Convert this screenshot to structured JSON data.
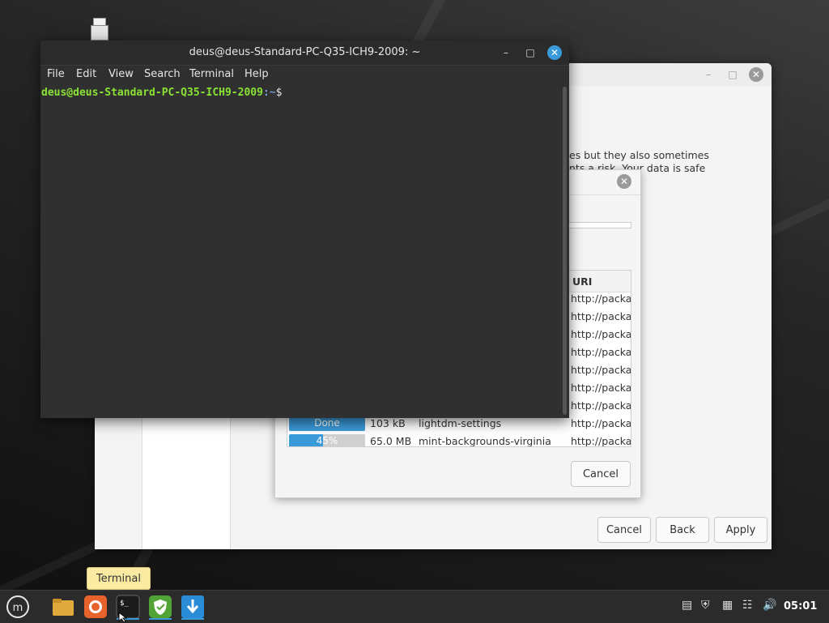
{
  "terminal": {
    "title": "deus@deus-Standard-PC-Q35-ICH9-2009: ~",
    "menu": [
      "File",
      "Edit",
      "View",
      "Search",
      "Terminal",
      "Help"
    ],
    "prompt_user": "deus@deus-Standard-PC-Q35-ICH9-2009",
    "prompt_path": ":~",
    "prompt_symbol": "$"
  },
  "back_window": {
    "text_line1": "es but they also sometimes",
    "text_line2": "nts a risk. Your data is safe",
    "buttons": {
      "cancel": "Cancel",
      "back": "Back",
      "apply": "Apply"
    }
  },
  "download_dialog": {
    "column_uri": "URI",
    "rows": [
      {
        "status": "",
        "size": "",
        "name": "",
        "uri": "http://packa"
      },
      {
        "status": "",
        "size": "",
        "name": "",
        "uri": "http://packa"
      },
      {
        "status": "",
        "size": "",
        "name": "",
        "uri": "http://packa"
      },
      {
        "status": "",
        "size": "",
        "name": "",
        "uri": "http://packa"
      },
      {
        "status": "",
        "size": "",
        "name": "",
        "uri": "http://packa"
      },
      {
        "status": "",
        "size": "",
        "name": "",
        "uri": "http://packa"
      },
      {
        "status": "",
        "size": "",
        "name": "",
        "uri": "http://packa"
      },
      {
        "status": "Done",
        "size": "103 kB",
        "name": "lightdm-settings",
        "uri": "http://packa"
      },
      {
        "status": "45%",
        "size": "65.0 MB",
        "name": "mint-backgrounds-virginia",
        "uri": "http://packa",
        "progress": 0.45
      }
    ],
    "cancel": "Cancel"
  },
  "tooltip": "Terminal",
  "taskbar": {
    "clock": "05:01",
    "items": [
      "mint-menu-icon",
      "files-icon",
      "firefox-icon",
      "terminal-icon",
      "shield-icon",
      "update-icon"
    ]
  },
  "colors": {
    "accent": "#3a9ad9",
    "prompt_user": "#8ae234",
    "prompt_path": "#729fcf"
  }
}
